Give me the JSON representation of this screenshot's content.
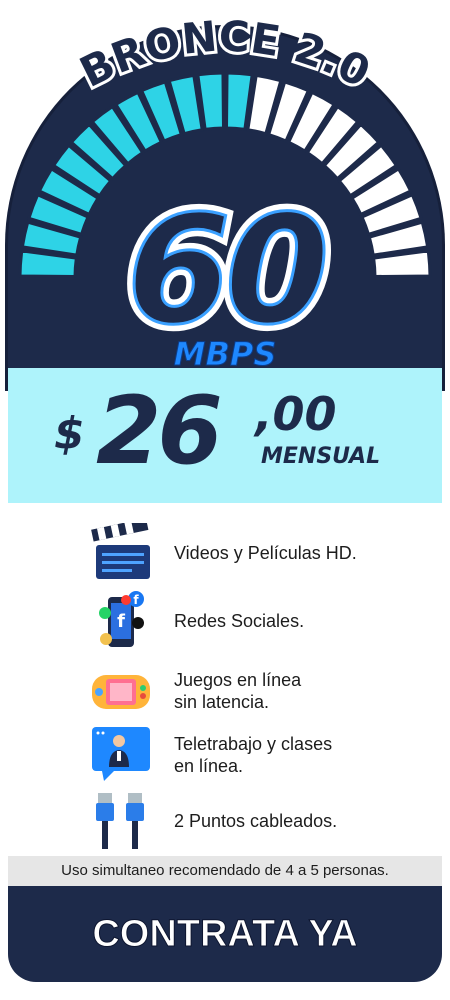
{
  "plan": {
    "name": "BRONCE 2.0",
    "speed_value": "60",
    "speed_unit": "MBPS",
    "speed_gauge_fill": 0.55
  },
  "price": {
    "currency": "$",
    "integer": "26",
    "decimals": ",00",
    "period": "MENSUAL"
  },
  "features": [
    {
      "icon": "clapperboard-icon",
      "label": "Videos y Películas HD."
    },
    {
      "icon": "social-media-phone-icon",
      "label": "Redes Sociales."
    },
    {
      "icon": "game-console-icon",
      "label": "Juegos en línea\nsin latencia."
    },
    {
      "icon": "video-call-icon",
      "label": "Teletrabajo y clases\nen línea."
    },
    {
      "icon": "ethernet-cable-icon",
      "label": "2 Puntos cableados."
    }
  ],
  "note": "Uso simultaneo recomendado de 4 a 5 personas.",
  "cta": "CONTRATA YA",
  "colors": {
    "navy": "#1d2a4a",
    "cyan": "#2ed3e6",
    "light_cyan": "#aef3fb",
    "blue_accent": "#1e88ff"
  }
}
